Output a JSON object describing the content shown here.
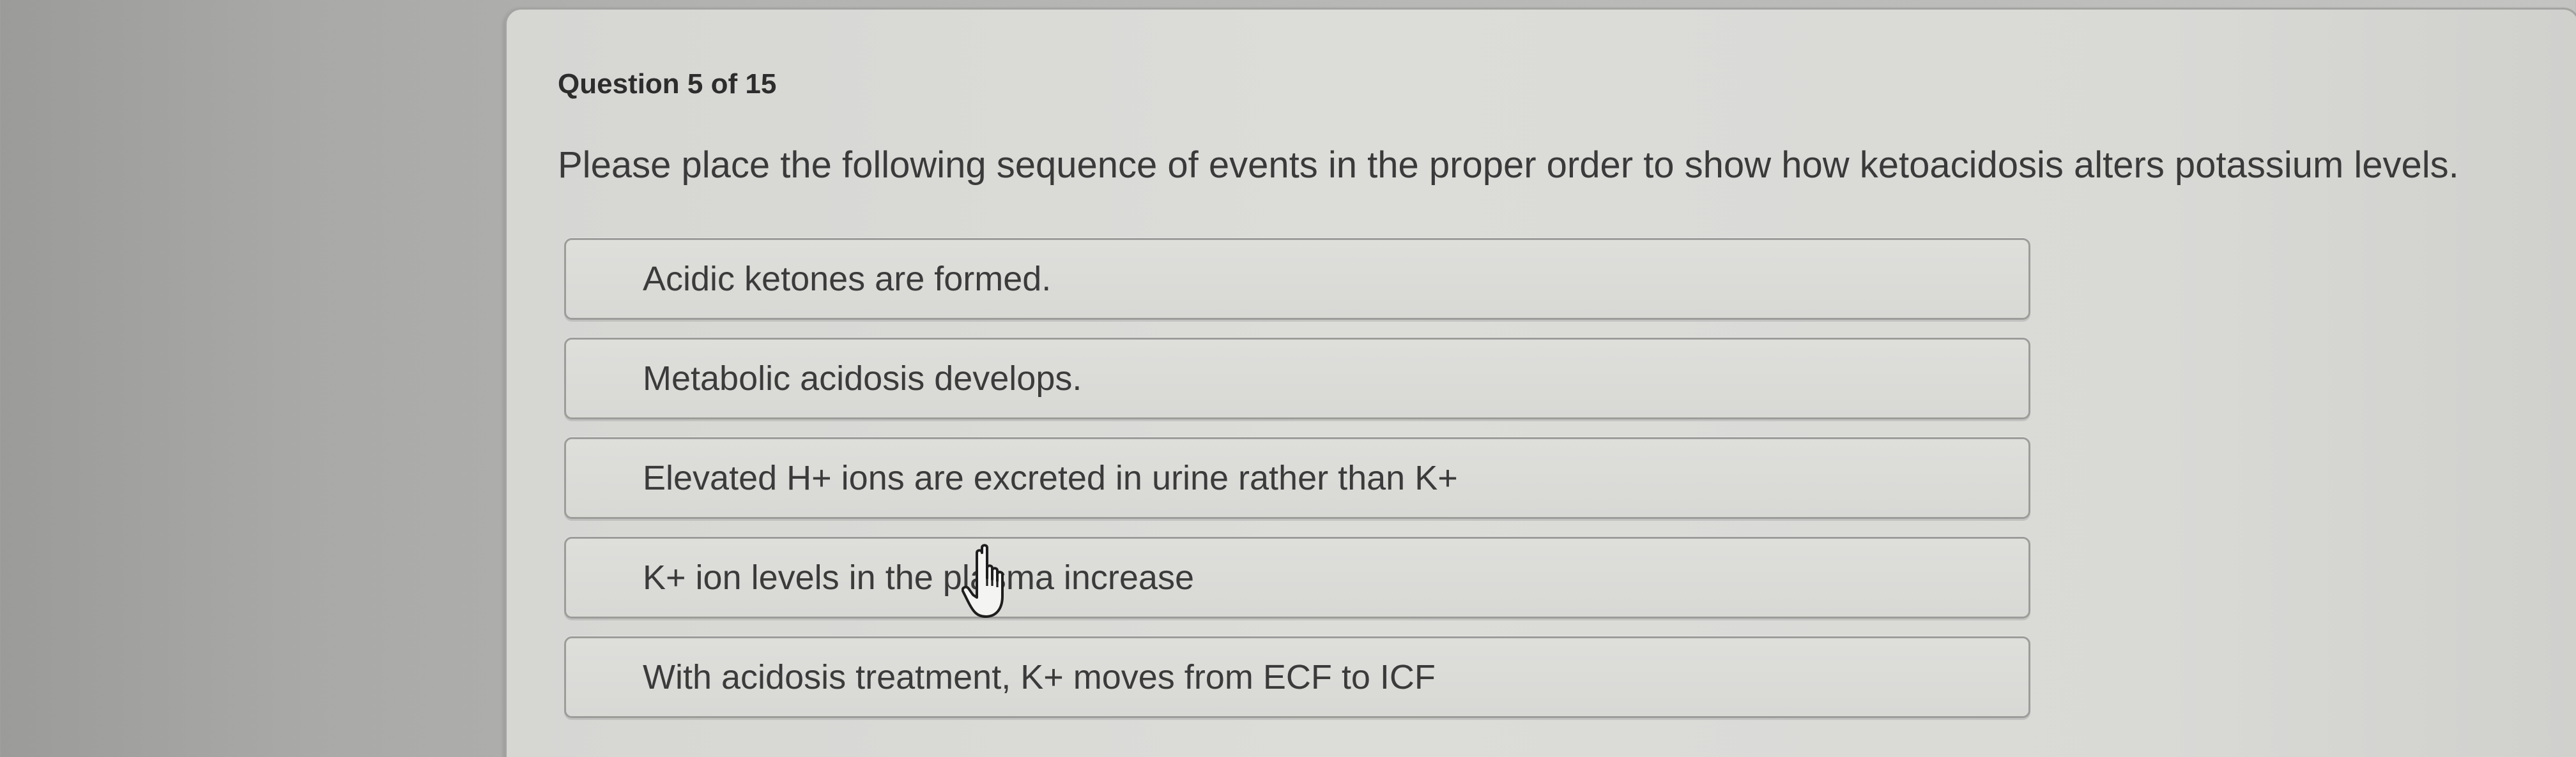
{
  "quiz": {
    "counter": "Question 5 of 15",
    "prompt": "Please place the following sequence of events in the proper order to show how ketoacidosis alters potassium levels.",
    "options": [
      {
        "label": "Acidic ketones are formed."
      },
      {
        "label": "Metabolic acidosis develops."
      },
      {
        "label": "Elevated H+ ions are excreted in urine rather than K+"
      },
      {
        "label": "K+ ion levels in the plasma increase"
      },
      {
        "label": "With acidosis treatment, K+ moves from ECF to ICF"
      }
    ]
  },
  "cursor": {
    "icon": "hand-pointer-icon"
  }
}
